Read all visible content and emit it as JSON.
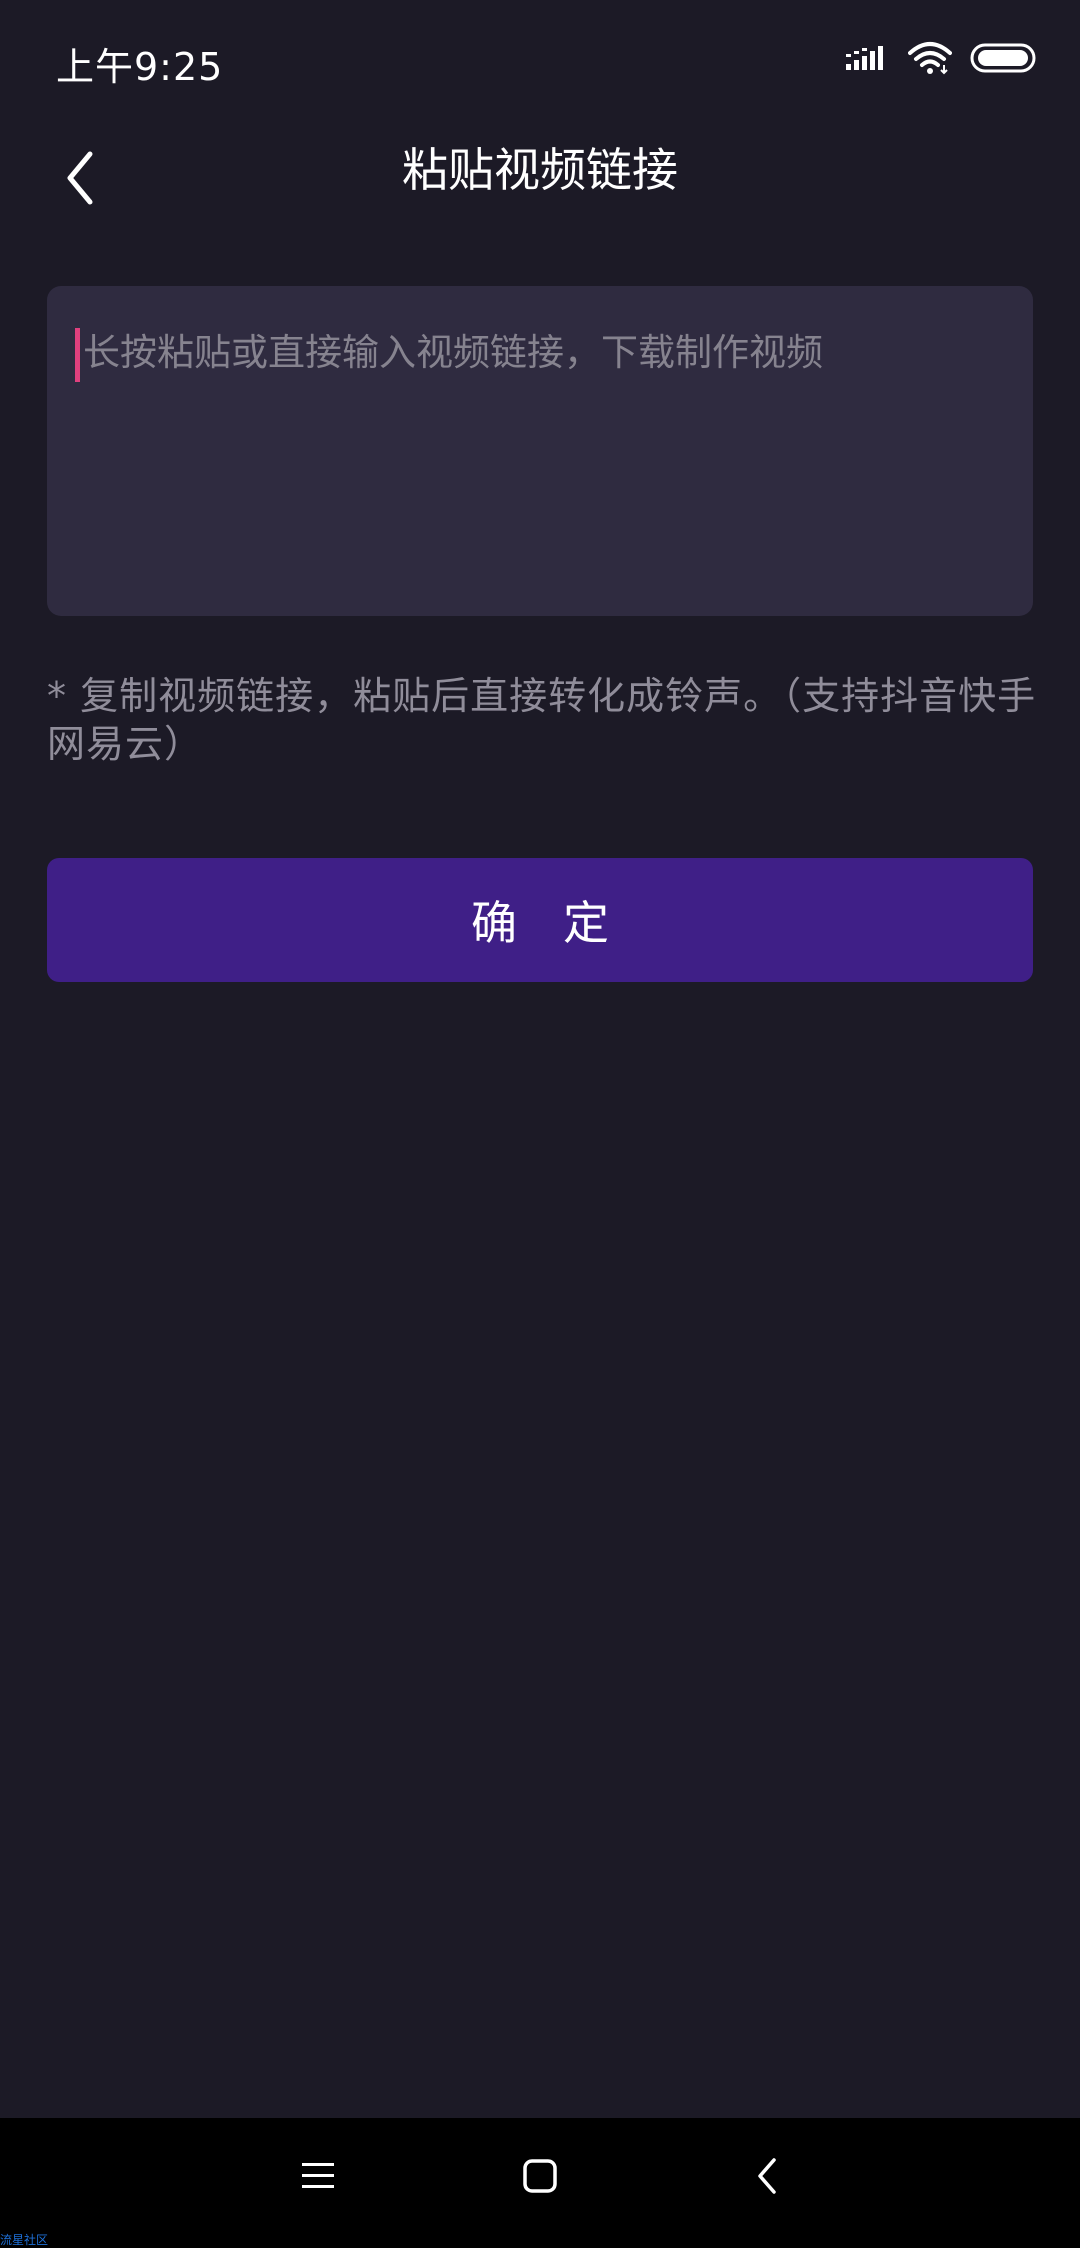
{
  "status_bar": {
    "time": "上午9:25"
  },
  "header": {
    "title": "粘贴视频链接"
  },
  "link_input": {
    "value": "",
    "placeholder": "长按粘贴或直接输入视频链接，下载制作视频"
  },
  "hint": {
    "text": "* 复制视频链接，粘贴后直接转化成铃声。（支持抖音快手网易云）"
  },
  "confirm_button": {
    "label": "确定"
  },
  "watermark": {
    "text": "流星社区"
  },
  "colors": {
    "background": "#1c1a26",
    "input_background": "#2f2b40",
    "accent_button": "#3f1f87",
    "caret": "#e0407e",
    "hint_text": "#908d9a"
  },
  "icons": {
    "back": "chevron-left-icon",
    "signal": "signal-icon",
    "wifi": "wifi-icon",
    "battery": "battery-icon",
    "nav_menu": "menu-icon",
    "nav_home": "home-icon",
    "nav_back": "back-icon"
  }
}
